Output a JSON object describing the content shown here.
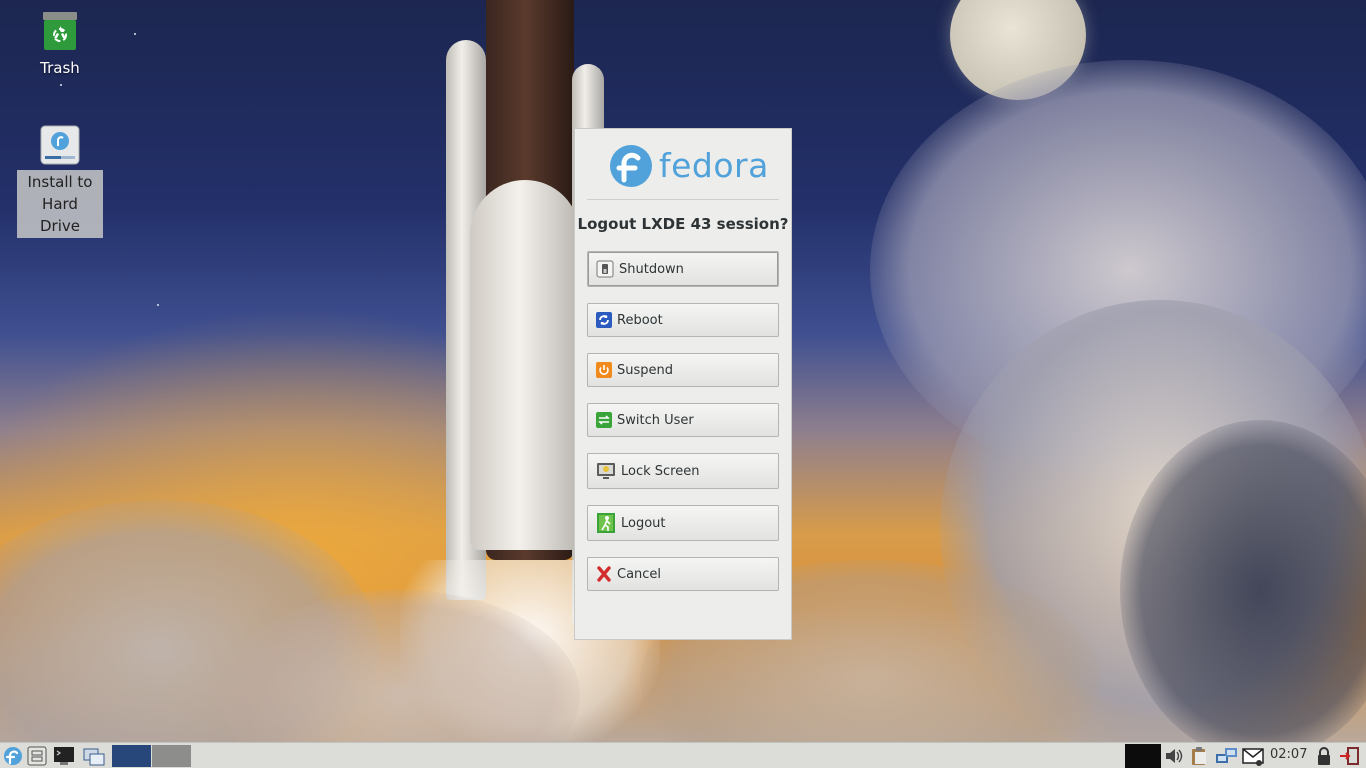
{
  "desktop": {
    "icons": [
      {
        "label": "Trash",
        "icon": "trash-icon"
      },
      {
        "label": "Install to\nHard Drive",
        "icon": "install-icon"
      }
    ]
  },
  "dialog": {
    "logo_text": "fedora",
    "title": "Logout LXDE 43 session?",
    "buttons": [
      {
        "label": "Shutdown",
        "icon": "shutdown-icon"
      },
      {
        "label": "Reboot",
        "icon": "reboot-icon"
      },
      {
        "label": "Suspend",
        "icon": "suspend-icon"
      },
      {
        "label": "Switch User",
        "icon": "switch-user-icon"
      },
      {
        "label": "Lock Screen",
        "icon": "lock-screen-icon"
      },
      {
        "label": "Logout",
        "icon": "logout-icon"
      },
      {
        "label": "Cancel",
        "icon": "cancel-icon"
      }
    ]
  },
  "taskbar": {
    "clock": "02:07",
    "launchers": [
      "fedora-menu-icon",
      "file-manager-icon",
      "terminal-icon",
      "window-switcher-icon"
    ],
    "tray": [
      "volume-icon",
      "clipboard-icon",
      "network-icon",
      "mail-icon",
      "lock-icon",
      "logout-icon"
    ]
  },
  "colors": {
    "fedora_blue": "#51a2da",
    "dialog_bg": "#ededeb",
    "taskbar_bg": "#dcdcd9",
    "desk_active": "#27477a"
  }
}
